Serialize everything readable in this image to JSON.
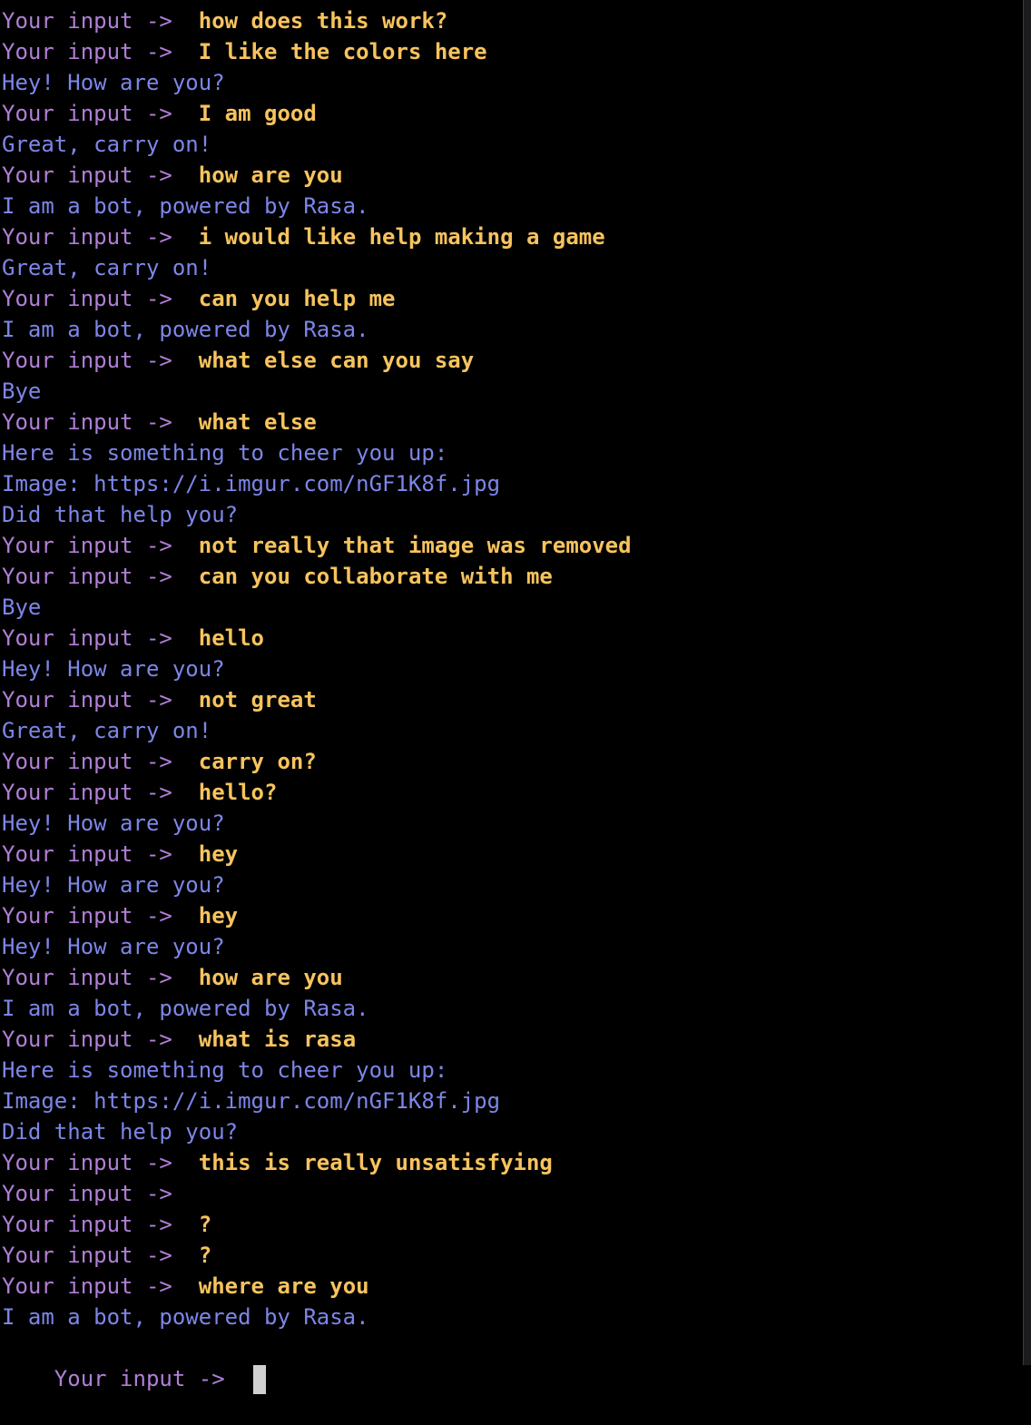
{
  "terminal": {
    "prompt": "Your input ->  ",
    "colors": {
      "background": "#000000",
      "prompt": "#b07fd6",
      "user_input": "#f7c35e",
      "bot_output": "#7d86e8"
    },
    "lines": [
      {
        "kind": "user",
        "text": "how does this work?"
      },
      {
        "kind": "user",
        "text": "I like the colors here"
      },
      {
        "kind": "bot",
        "text": "Hey! How are you?"
      },
      {
        "kind": "user",
        "text": "I am good"
      },
      {
        "kind": "bot",
        "text": "Great, carry on!"
      },
      {
        "kind": "user",
        "text": "how are you"
      },
      {
        "kind": "bot",
        "text": "I am a bot, powered by Rasa."
      },
      {
        "kind": "user",
        "text": "i would like help making a game"
      },
      {
        "kind": "bot",
        "text": "Great, carry on!"
      },
      {
        "kind": "user",
        "text": "can you help me"
      },
      {
        "kind": "bot",
        "text": "I am a bot, powered by Rasa."
      },
      {
        "kind": "user",
        "text": "what else can you say"
      },
      {
        "kind": "bot",
        "text": "Bye"
      },
      {
        "kind": "user",
        "text": "what else"
      },
      {
        "kind": "bot",
        "text": "Here is something to cheer you up:"
      },
      {
        "kind": "bot",
        "text": "Image: https://i.imgur.com/nGF1K8f.jpg"
      },
      {
        "kind": "bot",
        "text": "Did that help you?"
      },
      {
        "kind": "user",
        "text": "not really that image was removed"
      },
      {
        "kind": "user",
        "text": "can you collaborate with me"
      },
      {
        "kind": "bot",
        "text": "Bye"
      },
      {
        "kind": "user",
        "text": "hello"
      },
      {
        "kind": "bot",
        "text": "Hey! How are you?"
      },
      {
        "kind": "user",
        "text": "not great"
      },
      {
        "kind": "bot",
        "text": "Great, carry on!"
      },
      {
        "kind": "user",
        "text": "carry on?"
      },
      {
        "kind": "user",
        "text": "hello?"
      },
      {
        "kind": "bot",
        "text": "Hey! How are you?"
      },
      {
        "kind": "user",
        "text": "hey"
      },
      {
        "kind": "bot",
        "text": "Hey! How are you?"
      },
      {
        "kind": "user",
        "text": "hey"
      },
      {
        "kind": "bot",
        "text": "Hey! How are you?"
      },
      {
        "kind": "user",
        "text": "how are you"
      },
      {
        "kind": "bot",
        "text": "I am a bot, powered by Rasa."
      },
      {
        "kind": "user",
        "text": "what is rasa"
      },
      {
        "kind": "bot",
        "text": "Here is something to cheer you up:"
      },
      {
        "kind": "bot",
        "text": "Image: https://i.imgur.com/nGF1K8f.jpg"
      },
      {
        "kind": "bot",
        "text": "Did that help you?"
      },
      {
        "kind": "user",
        "text": "this is really unsatisfying"
      },
      {
        "kind": "user",
        "text": ""
      },
      {
        "kind": "user",
        "text": "?"
      },
      {
        "kind": "user",
        "text": "?"
      },
      {
        "kind": "user",
        "text": "where are you"
      },
      {
        "kind": "bot",
        "text": "I am a bot, powered by Rasa."
      }
    ],
    "active_input": ""
  }
}
